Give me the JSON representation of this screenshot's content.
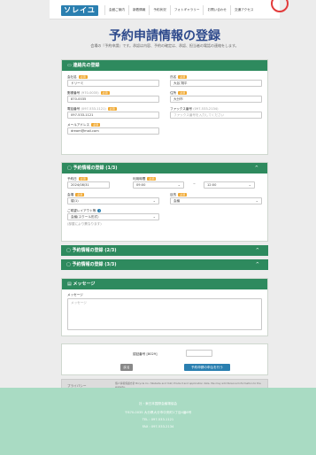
{
  "header": {
    "logo": "ソレイユ",
    "nav": [
      "会館ご案内",
      "新着情報",
      "予約状況",
      "フォトギャラリー",
      "お問い合わせ",
      "交通アクセス"
    ]
  },
  "page": {
    "title": "予約申請情報の登録",
    "subtitle": "会場の『予約申請』です。承認は内容、予約の確定は、承認、担当者の電話の連絡をします。"
  },
  "contact": {
    "heading": "連絡先の登録",
    "fields": {
      "name": {
        "label": "会社名",
        "req": "必須",
        "value": "ドリーミ"
      },
      "person": {
        "label": "氏名",
        "req": "必須",
        "value": "大谷 翔平"
      },
      "zip": {
        "label": "郵便番号",
        "note": "(970-0035)",
        "req": "必須",
        "value": "870-0035"
      },
      "address": {
        "label": "住所",
        "req": "必須",
        "value": "大分市"
      },
      "tel": {
        "label": "電話番号",
        "note": "(097-533-1121)",
        "req": "必須",
        "value": "097-533-1121"
      },
      "fax": {
        "label": "ファックス番号",
        "note": "(097-533-2134)",
        "placeholder": "ファックス番号を入力してください"
      },
      "email": {
        "label": "メールアドレス",
        "req": "必須",
        "value": "dream@mail.com"
      }
    }
  },
  "reservation1": {
    "heading": "予約情報の登録 (1/3)",
    "chevron": "^",
    "date": {
      "label": "予約日",
      "req": "必須",
      "value": "2024/08/31"
    },
    "time": {
      "label": "利用時間",
      "req": "必須",
      "start": "09:00",
      "sep": "~",
      "end": "12:00"
    },
    "room": {
      "label": "会場",
      "req": "必須",
      "value": "椿(1)"
    },
    "usage": {
      "label": "目的",
      "req": "必須",
      "value": "会議"
    },
    "layout": {
      "label": "ご希望レイアウト等",
      "value": "会議(スクール形式)",
      "hint": "(部屋により異なります)"
    }
  },
  "reservation2": {
    "heading": "予約情報の登録 (2/3)",
    "chevron": "^"
  },
  "reservation3": {
    "heading": "予約情報の登録 (3/3)",
    "chevron": "^"
  },
  "message": {
    "heading": "メッセージ",
    "label": "メッセージ",
    "placeholder": "メッセージ"
  },
  "actions": {
    "confirm_label": "認証番号 [8029]",
    "back": "戻る",
    "submit": "予約申請の申込を行う"
  },
  "privacy": {
    "label": "プライバシー",
    "text": "個人情報保護方針 Bicycle Co. (Website and Yoki) Product and application data. We may add Personal Information to the website."
  },
  "footer": {
    "org": "社・東日本国際会議場協会",
    "address": "〒870-0035 大分県大分市中央町1丁目4番8号",
    "tel": "TEL : 097-533-1121",
    "fax": "FAX : 097-533-2134"
  },
  "colors": {
    "accent": "#2e8a5e",
    "title": "#2e4a8c",
    "required": "#f0a830",
    "footer": "#a9dbc3"
  }
}
